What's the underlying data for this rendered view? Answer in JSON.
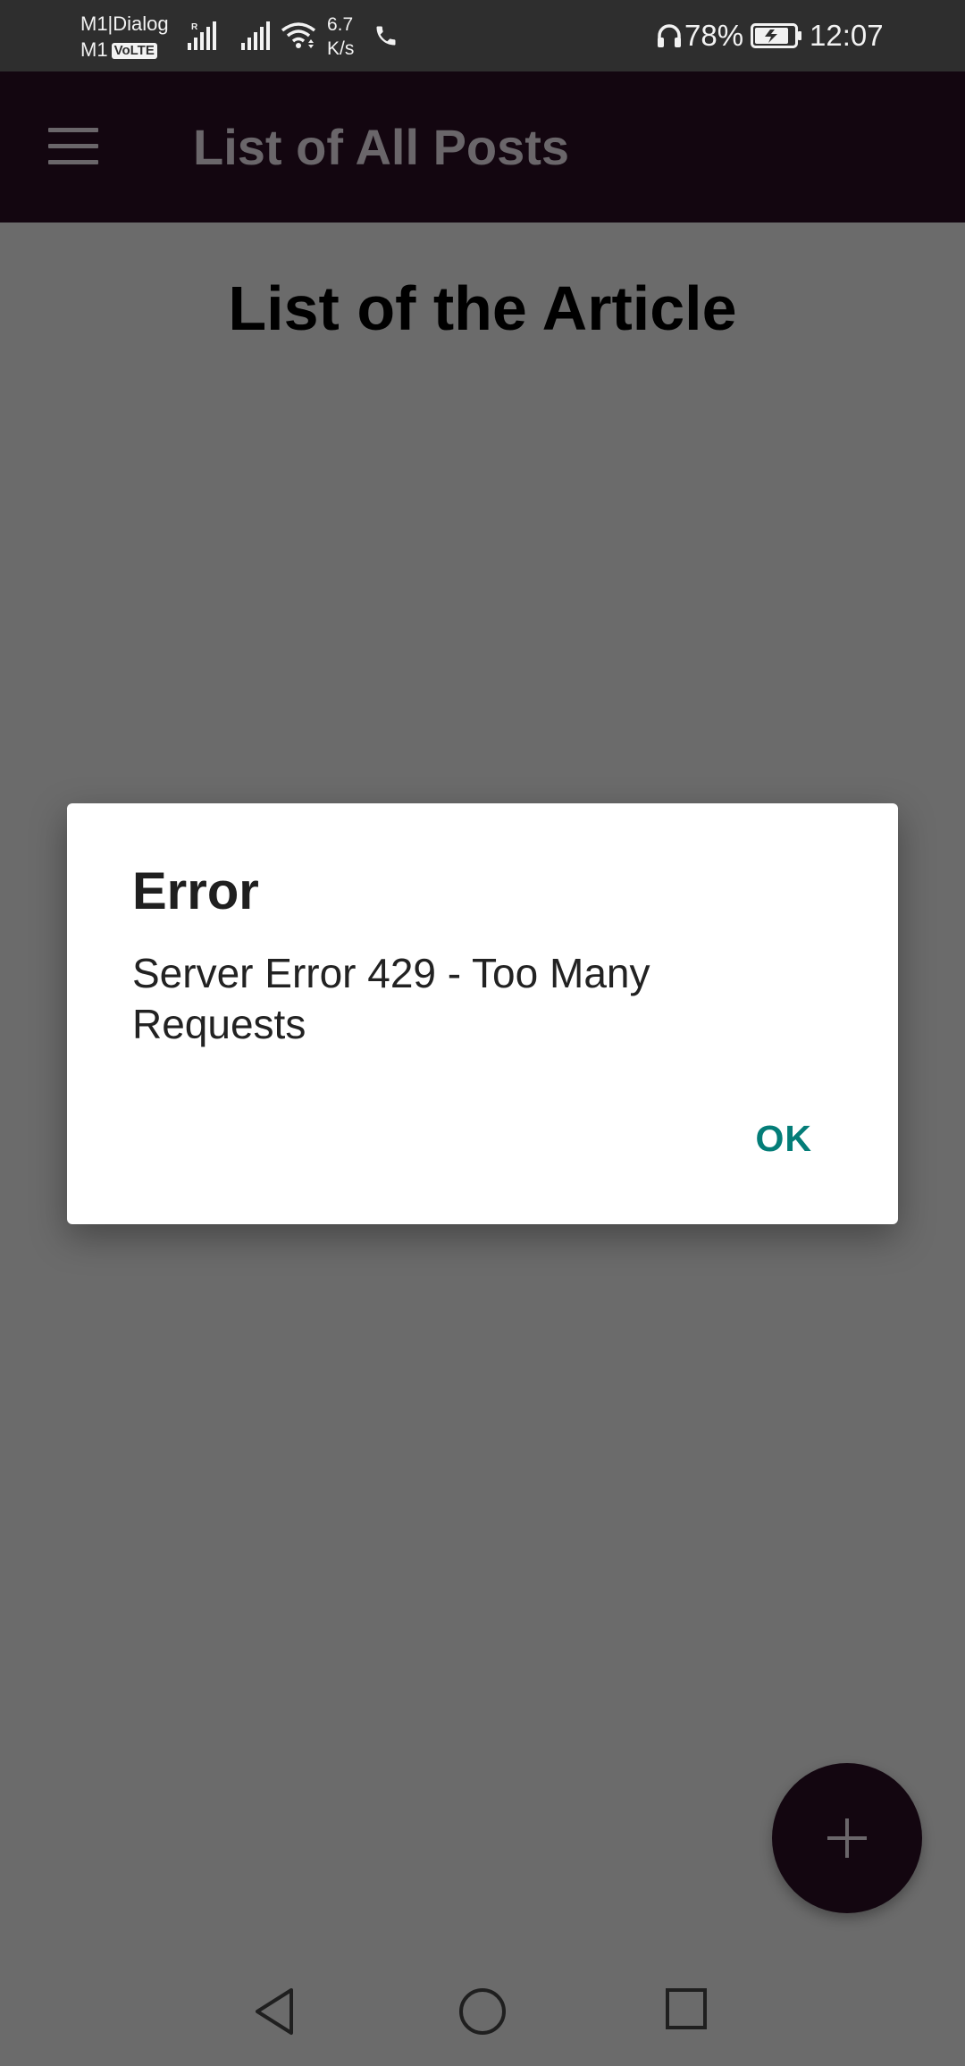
{
  "status_bar": {
    "carrier_line1": "M1|Dialog",
    "carrier_line2": "M1",
    "volte_badge": "VoLTE",
    "roaming_mark": "R",
    "net_speed_value": "6.7",
    "net_speed_unit": "K/s",
    "battery_percent": "78%",
    "time": "12:07",
    "icons": [
      "signal-icon",
      "wifi-icon",
      "call-icon",
      "headset-icon",
      "battery-charging-icon"
    ]
  },
  "app_bar": {
    "title": "List of All Posts",
    "menu_icon": "hamburger-menu-icon"
  },
  "content": {
    "heading": "List of the Article"
  },
  "dialog": {
    "title": "Error",
    "message": "Server Error 429 - Too Many Requests",
    "ok_label": "OK",
    "accent_color": "#047d78"
  },
  "fab": {
    "icon": "plus-icon",
    "color": "#130610"
  },
  "nav_bar": {
    "icons": [
      "back-icon",
      "home-icon",
      "recent-apps-icon"
    ]
  },
  "colors": {
    "scrim_background": "#6b6b6b",
    "status_bar": "#2e2e2e",
    "app_bar": "#130610"
  }
}
